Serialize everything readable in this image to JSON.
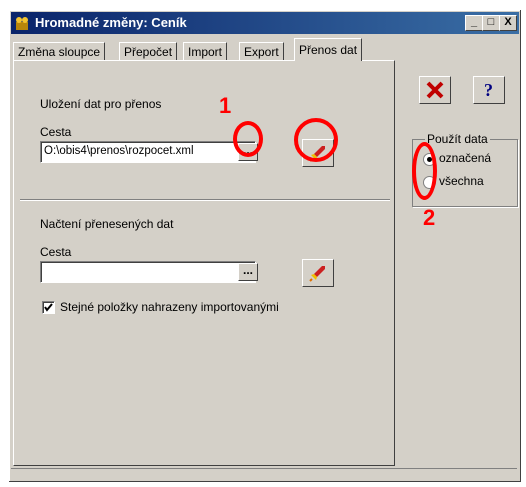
{
  "window": {
    "title": "Hromadné změny: Ceník",
    "controls": {
      "minimize": "_",
      "maximize": "□",
      "close": "X"
    }
  },
  "tabs": [
    {
      "label": "Změna sloupce",
      "active": false
    },
    {
      "label": "Přepočet",
      "active": false
    },
    {
      "label": "Import",
      "active": false
    },
    {
      "label": "Export",
      "active": false
    },
    {
      "label": "Přenos dat",
      "active": true
    }
  ],
  "export_section": {
    "heading": "Uložení dat pro přenos",
    "path_label": "Cesta",
    "path_value": "O:\\obis4\\prenos\\rozpocet.xml",
    "browse_label": "..."
  },
  "import_section": {
    "heading": "Načtení přenesených dat",
    "path_label": "Cesta",
    "path_value": "",
    "browse_label": "...",
    "replace_checkbox_label": "Stejné položky nahrazeny importovanými",
    "replace_checked": true
  },
  "use_data": {
    "group_label": "Použít data",
    "options": [
      {
        "label": "označená",
        "selected": true
      },
      {
        "label": "všechna",
        "selected": false
      }
    ]
  },
  "annotations": {
    "one": "1",
    "two": "2"
  },
  "icons": {
    "run": "rocket-icon",
    "cancel": "red-x-icon",
    "help": "question-icon"
  }
}
